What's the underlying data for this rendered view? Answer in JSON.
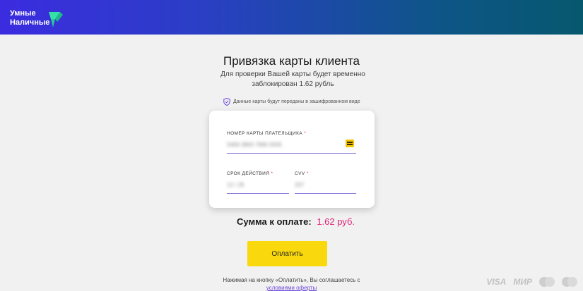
{
  "brand": {
    "line1": "Умные",
    "line2": "Наличные"
  },
  "page": {
    "title": "Привязка карты клиента",
    "subtitle": "Для проверки Вашей карты будет временно заблокирован 1.62 рубль",
    "secure_note": "Данные карты будут переданы в зашифрованном виде"
  },
  "card_form": {
    "card_number_label": "Номер карты плательщика",
    "card_number_value": "5469 3800 7890 0005",
    "expiry_label": "Срок действия",
    "expiry_value": "12 / 26",
    "cvv_label": "CVV",
    "cvv_value": "207",
    "required_mark": "*"
  },
  "summary": {
    "label": "Сумма к оплате:",
    "amount": "1.62 руб."
  },
  "pay_button": {
    "label": "Оплатить"
  },
  "legal": {
    "text": "Нажимая на кнопку «Оплатить», Вы соглашаетесь с ",
    "link": "условиями оферты"
  },
  "payment_logos": {
    "visa": "VISA",
    "mir": "МИР"
  },
  "colors": {
    "accent_yellow": "#f9d90d",
    "amount_pink": "#e0247a",
    "link_purple": "#6b49d9",
    "header_start": "#3b2ce0",
    "header_end": "#06586e"
  }
}
